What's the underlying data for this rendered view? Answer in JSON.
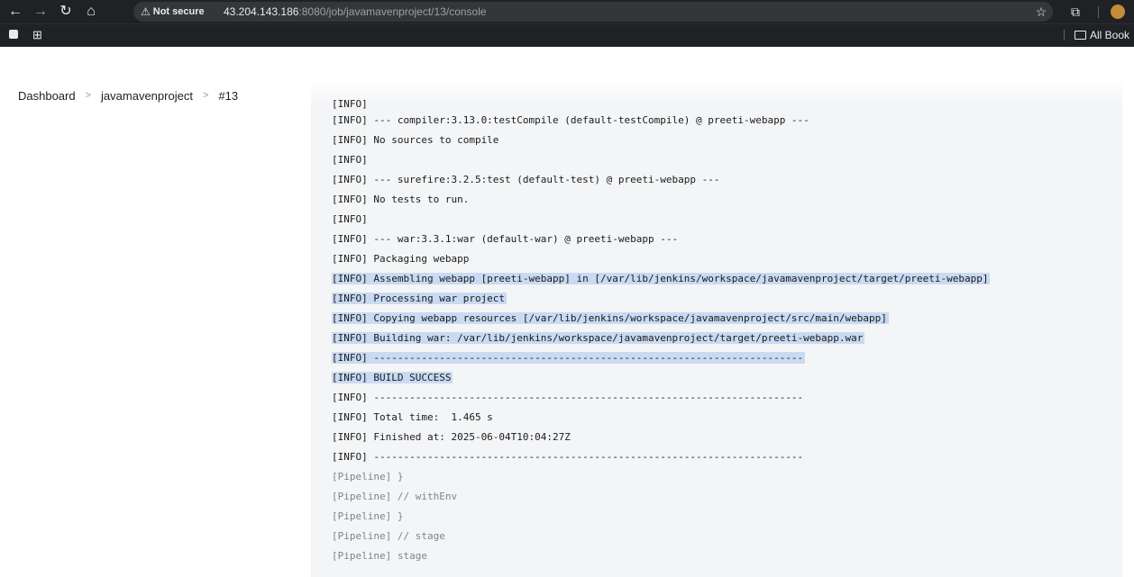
{
  "browser": {
    "security_label": "Not secure",
    "url_host": "43.204.143.186",
    "url_path": ":8080/job/javamavenproject/13/console",
    "bookmarks_all": "All Book"
  },
  "breadcrumb": {
    "items": [
      "Dashboard",
      "javamavenproject",
      "#13"
    ]
  },
  "console": {
    "lines": [
      {
        "text": "[INFO]",
        "sel": false,
        "pipe": false
      },
      {
        "text": "[INFO] --- compiler:3.13.0:testCompile (default-testCompile) @ preeti-webapp ---",
        "sel": false,
        "pipe": false
      },
      {
        "text": "[INFO] No sources to compile",
        "sel": false,
        "pipe": false
      },
      {
        "text": "[INFO]",
        "sel": false,
        "pipe": false
      },
      {
        "text": "[INFO] --- surefire:3.2.5:test (default-test) @ preeti-webapp ---",
        "sel": false,
        "pipe": false
      },
      {
        "text": "[INFO] No tests to run.",
        "sel": false,
        "pipe": false
      },
      {
        "text": "[INFO]",
        "sel": false,
        "pipe": false
      },
      {
        "text": "[INFO] --- war:3.3.1:war (default-war) @ preeti-webapp ---",
        "sel": false,
        "pipe": false
      },
      {
        "text": "[INFO] Packaging webapp",
        "sel": false,
        "pipe": false
      },
      {
        "text": "[INFO] Assembling webapp [preeti-webapp] in [/var/lib/jenkins/workspace/javamavenproject/target/preeti-webapp]",
        "sel": true,
        "pipe": false
      },
      {
        "text": "[INFO] Processing war project",
        "sel": true,
        "pipe": false
      },
      {
        "text": "[INFO] Copying webapp resources [/var/lib/jenkins/workspace/javamavenproject/src/main/webapp]",
        "sel": true,
        "pipe": false
      },
      {
        "text": "[INFO] Building war: /var/lib/jenkins/workspace/javamavenproject/target/preeti-webapp.war",
        "sel": true,
        "pipe": false
      },
      {
        "text": "[INFO] ------------------------------------------------------------------------",
        "sel": true,
        "pipe": false
      },
      {
        "text": "[INFO] BUILD SUCCESS",
        "sel": true,
        "pipe": false
      },
      {
        "text": "[INFO] ------------------------------------------------------------------------",
        "sel": false,
        "pipe": false
      },
      {
        "text": "[INFO] Total time:  1.465 s",
        "sel": false,
        "pipe": false
      },
      {
        "text": "[INFO] Finished at: 2025-06-04T10:04:27Z",
        "sel": false,
        "pipe": false
      },
      {
        "text": "[INFO] ------------------------------------------------------------------------",
        "sel": false,
        "pipe": false
      },
      {
        "text": "[Pipeline] }",
        "sel": false,
        "pipe": true
      },
      {
        "text": "[Pipeline] // withEnv",
        "sel": false,
        "pipe": true
      },
      {
        "text": "[Pipeline] }",
        "sel": false,
        "pipe": true
      },
      {
        "text": "[Pipeline] // stage",
        "sel": false,
        "pipe": true
      },
      {
        "text": "[Pipeline] stage",
        "sel": false,
        "pipe": true
      }
    ]
  }
}
